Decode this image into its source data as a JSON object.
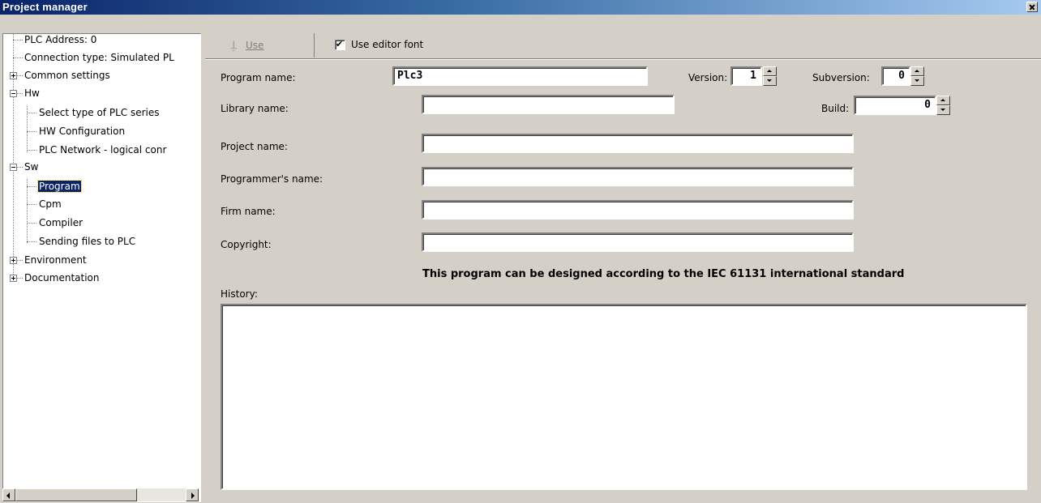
{
  "window": {
    "title": "Project manager"
  },
  "tree": {
    "items": [
      {
        "label": "PLC Address: 0"
      },
      {
        "label": "Connection type: Simulated PL"
      },
      {
        "label": "Common settings",
        "expander": "+"
      },
      {
        "label": "Hw",
        "expander": "-"
      },
      {
        "label": "Select type of PLC series"
      },
      {
        "label": "HW Configuration"
      },
      {
        "label": "PLC Network - logical conr"
      },
      {
        "label": "Sw",
        "expander": "-"
      },
      {
        "label": "Program",
        "selected": true
      },
      {
        "label": "Cpm"
      },
      {
        "label": "Compiler"
      },
      {
        "label": "Sending files to PLC"
      },
      {
        "label": "Environment",
        "expander": "+"
      },
      {
        "label": "Documentation",
        "expander": "+"
      }
    ]
  },
  "toolbar": {
    "use_label": "Use",
    "use_editor_font_label": "Use editor font",
    "use_editor_font_checked": true
  },
  "form": {
    "program_name_label": "Program name:",
    "program_name_value": "Plc3",
    "version_label": "Version:",
    "version_value": "1",
    "subversion_label": "Subversion:",
    "subversion_value": "0",
    "library_name_label": "Library name:",
    "library_name_value": "",
    "build_label": "Build:",
    "build_value": "0",
    "project_name_label": "Project name:",
    "project_name_value": "",
    "programmer_name_label": "Programmer's name:",
    "programmer_name_value": "",
    "firm_name_label": "Firm name:",
    "firm_name_value": "",
    "copyright_label": "Copyright:",
    "copyright_value": "",
    "iec_note": "This program can be designed according to the IEC 61131 international standard",
    "history_label": "History:",
    "history_value": ""
  }
}
